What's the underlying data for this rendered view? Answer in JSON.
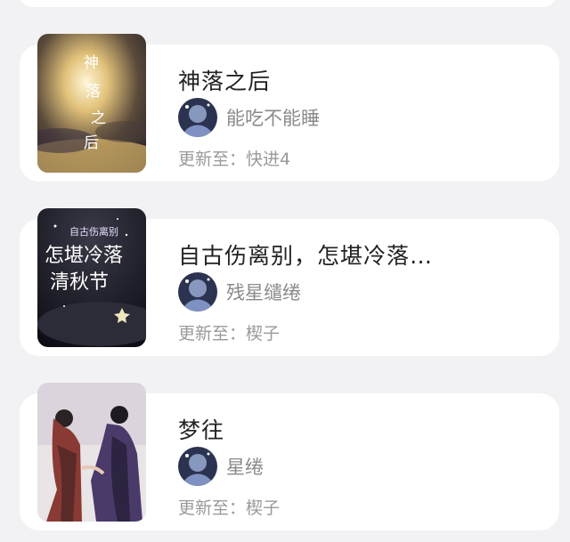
{
  "books": [
    {
      "title": "神落之后",
      "author": "能吃不能睡",
      "update_prefix": "更新至：",
      "update_value": "快进4",
      "cover_text": "神落之后",
      "cover_theme": "golden-sky"
    },
    {
      "title": "自古伤离别，怎堪冷落…",
      "author": "残星缱绻",
      "update_prefix": "更新至：",
      "update_value": "楔子",
      "cover_text": "自古伤离别 怎堪冷落清秋节",
      "cover_theme": "night-stars"
    },
    {
      "title": "梦往",
      "author": "星绻",
      "update_prefix": "更新至：",
      "update_value": "楔子",
      "cover_text": "",
      "cover_theme": "illustrated-figures"
    }
  ],
  "colors": {
    "background": "#f2f2f4",
    "card": "#ffffff",
    "title": "#222222",
    "meta": "#9a9a9a"
  }
}
